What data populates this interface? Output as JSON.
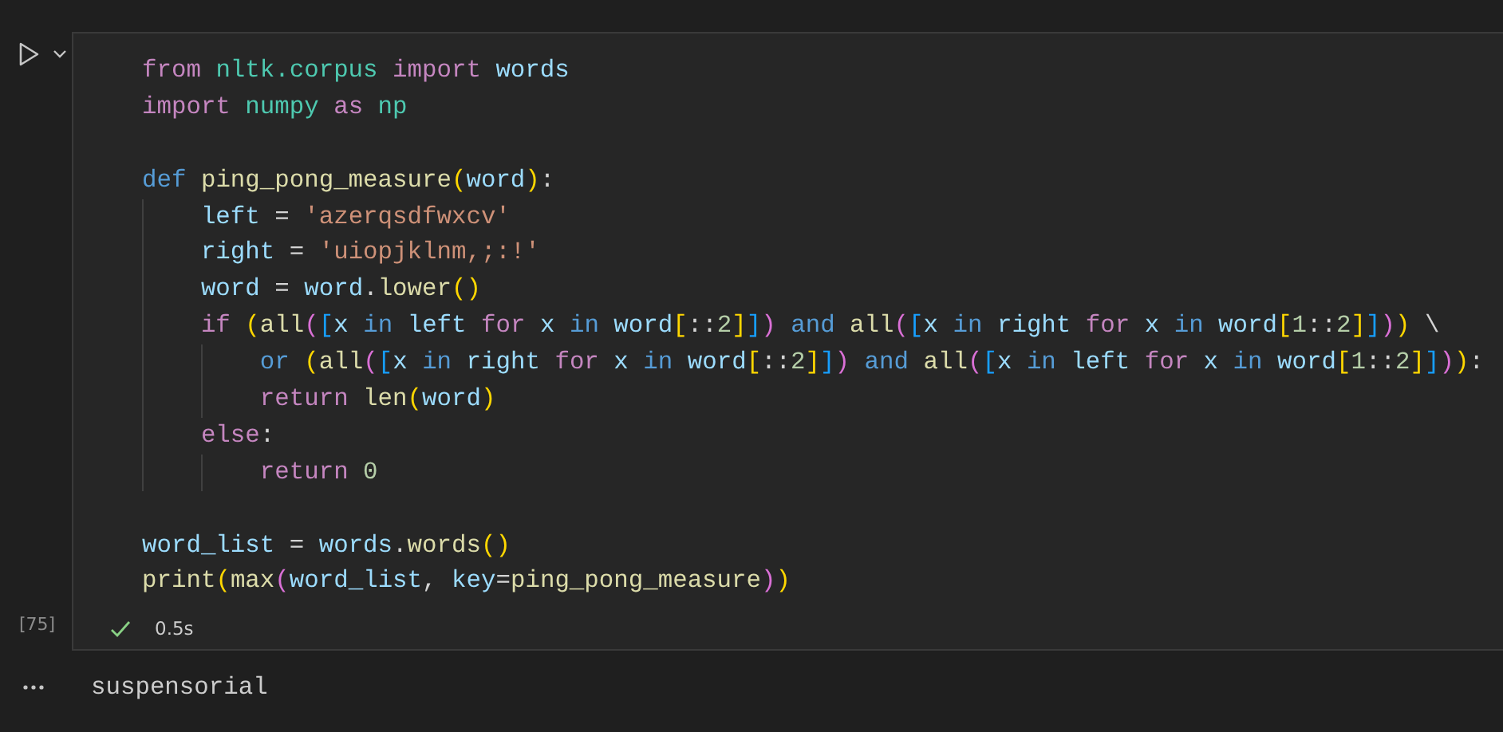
{
  "cell": {
    "execution_count": "[75]",
    "succeeded": true,
    "duration": "0.5s",
    "lines": [
      {
        "tokens": [
          {
            "kind": "ctl",
            "text": "from "
          },
          {
            "kind": "mod",
            "text": "nltk.corpus "
          },
          {
            "kind": "ctl",
            "text": "import "
          },
          {
            "kind": "var",
            "text": "words"
          }
        ]
      },
      {
        "tokens": [
          {
            "kind": "ctl",
            "text": "import "
          },
          {
            "kind": "mod",
            "text": "numpy "
          },
          {
            "kind": "ctl",
            "text": "as "
          },
          {
            "kind": "mod",
            "text": "np"
          }
        ]
      },
      {
        "gap_before": true,
        "tokens": [
          {
            "kind": "kw",
            "text": "def "
          },
          {
            "kind": "fn",
            "text": "ping_pong_measure"
          },
          {
            "kind": "b1",
            "text": "("
          },
          {
            "kind": "var",
            "text": "word"
          },
          {
            "kind": "b1",
            "text": ")"
          },
          {
            "kind": "txt",
            "text": ":"
          }
        ]
      },
      {
        "tokens": [
          {
            "kind": "var",
            "text": "    left"
          },
          {
            "kind": "txt",
            "text": " = "
          },
          {
            "kind": "str",
            "text": "'azerqsdfwxcv'"
          }
        ]
      },
      {
        "tokens": [
          {
            "kind": "var",
            "text": "    right"
          },
          {
            "kind": "txt",
            "text": " = "
          },
          {
            "kind": "str",
            "text": "'uiopjklnm,;:!'"
          }
        ]
      },
      {
        "tokens": [
          {
            "kind": "var",
            "text": "    word"
          },
          {
            "kind": "txt",
            "text": " = "
          },
          {
            "kind": "var",
            "text": "word"
          },
          {
            "kind": "txt",
            "text": "."
          },
          {
            "kind": "fn",
            "text": "lower"
          },
          {
            "kind": "b1",
            "text": "()"
          }
        ]
      },
      {
        "tokens": [
          {
            "kind": "ctl",
            "text": "    if "
          },
          {
            "kind": "b1",
            "text": "("
          },
          {
            "kind": "fn",
            "text": "all"
          },
          {
            "kind": "b2",
            "text": "("
          },
          {
            "kind": "b3",
            "text": "["
          },
          {
            "kind": "var",
            "text": "x "
          },
          {
            "kind": "kw",
            "text": "in "
          },
          {
            "kind": "var",
            "text": "left "
          },
          {
            "kind": "ctl",
            "text": "for "
          },
          {
            "kind": "var",
            "text": "x "
          },
          {
            "kind": "kw",
            "text": "in "
          },
          {
            "kind": "var",
            "text": "word"
          },
          {
            "kind": "b1",
            "text": "["
          },
          {
            "kind": "txt",
            "text": "::"
          },
          {
            "kind": "num",
            "text": "2"
          },
          {
            "kind": "b1",
            "text": "]"
          },
          {
            "kind": "b3",
            "text": "]"
          },
          {
            "kind": "b2",
            "text": ") "
          },
          {
            "kind": "kw",
            "text": "and "
          },
          {
            "kind": "fn",
            "text": "all"
          },
          {
            "kind": "b2",
            "text": "("
          },
          {
            "kind": "b3",
            "text": "["
          },
          {
            "kind": "var",
            "text": "x "
          },
          {
            "kind": "kw",
            "text": "in "
          },
          {
            "kind": "var",
            "text": "right "
          },
          {
            "kind": "ctl",
            "text": "for "
          },
          {
            "kind": "var",
            "text": "x "
          },
          {
            "kind": "kw",
            "text": "in "
          },
          {
            "kind": "var",
            "text": "word"
          },
          {
            "kind": "b1",
            "text": "["
          },
          {
            "kind": "num",
            "text": "1"
          },
          {
            "kind": "txt",
            "text": "::"
          },
          {
            "kind": "num",
            "text": "2"
          },
          {
            "kind": "b1",
            "text": "]"
          },
          {
            "kind": "b3",
            "text": "]"
          },
          {
            "kind": "b2",
            "text": ")"
          },
          {
            "kind": "b1",
            "text": ")"
          },
          {
            "kind": "txt",
            "text": " \\"
          }
        ]
      },
      {
        "tokens": [
          {
            "kind": "kw",
            "text": "        or "
          },
          {
            "kind": "b1",
            "text": "("
          },
          {
            "kind": "fn",
            "text": "all"
          },
          {
            "kind": "b2",
            "text": "("
          },
          {
            "kind": "b3",
            "text": "["
          },
          {
            "kind": "var",
            "text": "x "
          },
          {
            "kind": "kw",
            "text": "in "
          },
          {
            "kind": "var",
            "text": "right "
          },
          {
            "kind": "ctl",
            "text": "for "
          },
          {
            "kind": "var",
            "text": "x "
          },
          {
            "kind": "kw",
            "text": "in "
          },
          {
            "kind": "var",
            "text": "word"
          },
          {
            "kind": "b1",
            "text": "["
          },
          {
            "kind": "txt",
            "text": "::"
          },
          {
            "kind": "num",
            "text": "2"
          },
          {
            "kind": "b1",
            "text": "]"
          },
          {
            "kind": "b3",
            "text": "]"
          },
          {
            "kind": "b2",
            "text": ") "
          },
          {
            "kind": "kw",
            "text": "and "
          },
          {
            "kind": "fn",
            "text": "all"
          },
          {
            "kind": "b2",
            "text": "("
          },
          {
            "kind": "b3",
            "text": "["
          },
          {
            "kind": "var",
            "text": "x "
          },
          {
            "kind": "kw",
            "text": "in "
          },
          {
            "kind": "var",
            "text": "left "
          },
          {
            "kind": "ctl",
            "text": "for "
          },
          {
            "kind": "var",
            "text": "x "
          },
          {
            "kind": "kw",
            "text": "in "
          },
          {
            "kind": "var",
            "text": "word"
          },
          {
            "kind": "b1",
            "text": "["
          },
          {
            "kind": "num",
            "text": "1"
          },
          {
            "kind": "txt",
            "text": "::"
          },
          {
            "kind": "num",
            "text": "2"
          },
          {
            "kind": "b1",
            "text": "]"
          },
          {
            "kind": "b3",
            "text": "]"
          },
          {
            "kind": "b2",
            "text": ")"
          },
          {
            "kind": "b1",
            "text": ")"
          },
          {
            "kind": "txt",
            "text": ":"
          }
        ]
      },
      {
        "tokens": [
          {
            "kind": "ctl",
            "text": "        return "
          },
          {
            "kind": "fn",
            "text": "len"
          },
          {
            "kind": "b1",
            "text": "("
          },
          {
            "kind": "var",
            "text": "word"
          },
          {
            "kind": "b1",
            "text": ")"
          }
        ]
      },
      {
        "tokens": [
          {
            "kind": "ctl",
            "text": "    else"
          },
          {
            "kind": "txt",
            "text": ":"
          }
        ]
      },
      {
        "tokens": [
          {
            "kind": "ctl",
            "text": "        return "
          },
          {
            "kind": "num",
            "text": "0"
          }
        ]
      },
      {
        "gap_before": true,
        "tokens": [
          {
            "kind": "var",
            "text": "word_list"
          },
          {
            "kind": "txt",
            "text": " = "
          },
          {
            "kind": "var",
            "text": "words"
          },
          {
            "kind": "txt",
            "text": "."
          },
          {
            "kind": "fn",
            "text": "words"
          },
          {
            "kind": "b1",
            "text": "()"
          }
        ]
      },
      {
        "tokens": [
          {
            "kind": "fn",
            "text": "print"
          },
          {
            "kind": "b1",
            "text": "("
          },
          {
            "kind": "fn",
            "text": "max"
          },
          {
            "kind": "b2",
            "text": "("
          },
          {
            "kind": "var",
            "text": "word_list"
          },
          {
            "kind": "txt",
            "text": ", "
          },
          {
            "kind": "var",
            "text": "key"
          },
          {
            "kind": "txt",
            "text": "="
          },
          {
            "kind": "fn",
            "text": "ping_pong_measure"
          },
          {
            "kind": "b2",
            "text": ")"
          },
          {
            "kind": "b1",
            "text": ")"
          }
        ]
      }
    ]
  },
  "output": {
    "text": "suspensorial"
  }
}
